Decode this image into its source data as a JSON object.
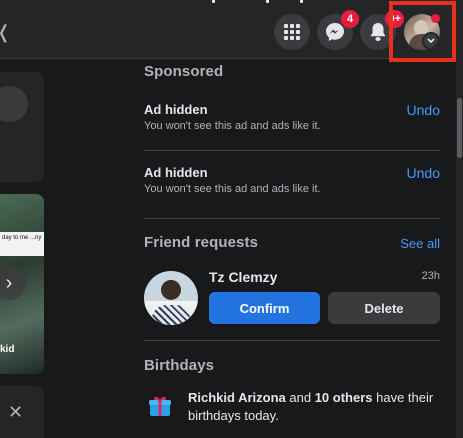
{
  "topbar": {
    "messenger_badge": "4",
    "notifications_badge": "0+"
  },
  "left_feed": {
    "story_caption": "day to me ...ny",
    "story_name": "kid"
  },
  "sponsored": {
    "title": "Sponsored",
    "ads": [
      {
        "title": "Ad hidden",
        "subtitle": "You won't see this ad and ads like it.",
        "action": "Undo"
      },
      {
        "title": "Ad hidden",
        "subtitle": "You won't see this ad and ads like it.",
        "action": "Undo"
      }
    ]
  },
  "friend_requests": {
    "title": "Friend requests",
    "see_all": "See all",
    "request": {
      "name": "Tz Clemzy",
      "time": "23h",
      "confirm_label": "Confirm",
      "delete_label": "Delete"
    }
  },
  "birthdays": {
    "title": "Birthdays",
    "name": "Richkid Arizona",
    "connector": " and ",
    "others": "10 others",
    "suffix": " have their birthdays today."
  },
  "colors": {
    "background": "#18191a",
    "surface": "#242526",
    "accent": "#2374e1",
    "link": "#4599ff",
    "badge": "#e41e3f",
    "highlight": "#e5311d"
  },
  "icons": [
    "menu-grid-icon",
    "messenger-icon",
    "bell-icon",
    "chevron-down-icon",
    "gift-icon",
    "close-icon",
    "chevron-right-icon"
  ]
}
